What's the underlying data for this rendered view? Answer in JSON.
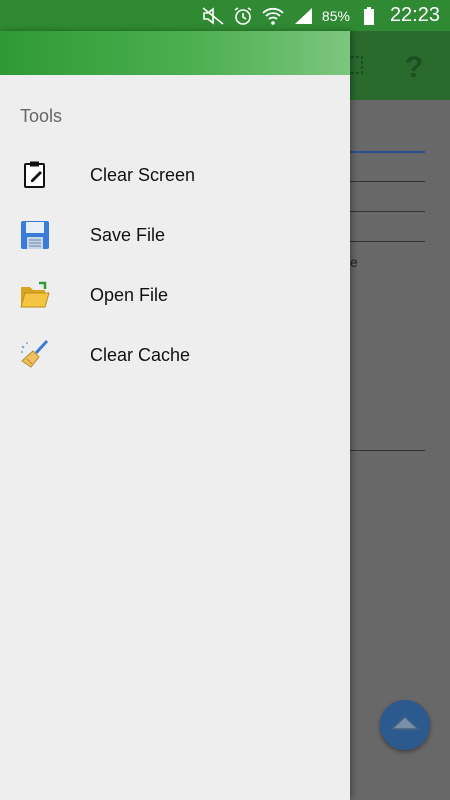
{
  "status_bar": {
    "icons": [
      "mute-icon",
      "alarm-icon",
      "wifi-icon",
      "signal-icon",
      "battery-icon"
    ],
    "battery": "85%",
    "time": "22:23"
  },
  "drawer": {
    "section_title": "Tools",
    "items": [
      {
        "label": "Clear Screen",
        "icon": "clipboard-icon"
      },
      {
        "label": "Save File",
        "icon": "floppy-disk-icon"
      },
      {
        "label": "Open File",
        "icon": "open-folder-icon"
      },
      {
        "label": "Clear Cache",
        "icon": "broom-icon"
      }
    ]
  },
  "background": {
    "toolbar_icons": [
      "grid-icon",
      "help-icon"
    ],
    "partial_text": "e"
  },
  "colors": {
    "status_bar": "#2f8a33",
    "drawer_header": "#4caf50",
    "drawer_bg": "#eeeeee",
    "fab": "#2d5a8e"
  }
}
